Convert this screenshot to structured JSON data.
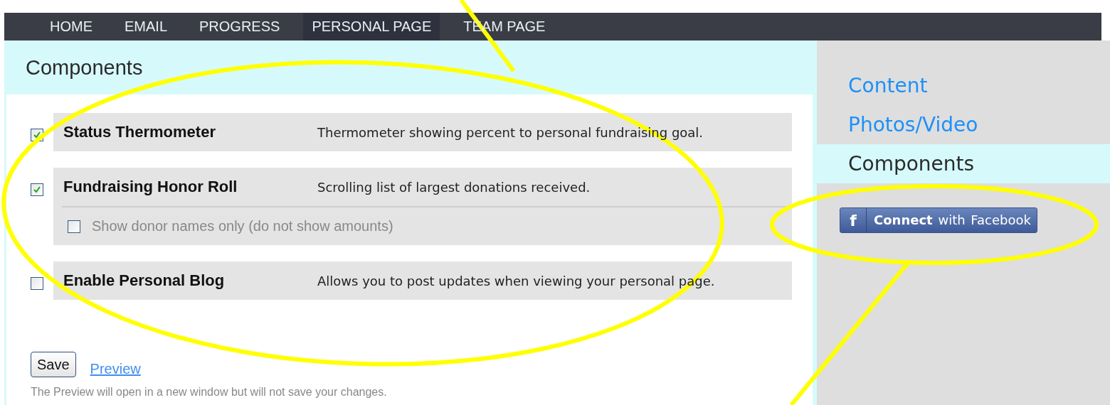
{
  "nav": [
    {
      "label": "HOME",
      "selected": false
    },
    {
      "label": "EMAIL",
      "selected": false
    },
    {
      "label": "PROGRESS",
      "selected": false
    },
    {
      "label": "PERSONAL PAGE",
      "selected": true
    },
    {
      "label": "TEAM PAGE",
      "selected": false
    }
  ],
  "panel": {
    "title": "Components",
    "components": [
      {
        "name": "Status Thermometer",
        "description": "Thermometer showing percent to personal fundraising goal.",
        "checked": true
      },
      {
        "name": "Fundraising Honor Roll",
        "description": "Scrolling list of largest donations received.",
        "checked": true,
        "options": [
          {
            "label": "Show donor names only (do not show amounts)",
            "checked": false
          }
        ]
      },
      {
        "name": "Enable Personal Blog",
        "description": "Allows you to post updates when viewing your personal page.",
        "checked": false
      }
    ],
    "save_button": "Save",
    "preview_link": "Preview",
    "note": "The Preview will open in a new window but will not save your changes."
  },
  "sidebar": {
    "items": [
      {
        "label": "Content",
        "selected": false
      },
      {
        "label": "Photos/Video",
        "selected": false
      },
      {
        "label": "Components",
        "selected": true
      }
    ],
    "facebook_button": {
      "badge": "f",
      "label": "**Connect** with Facebook"
    }
  }
}
